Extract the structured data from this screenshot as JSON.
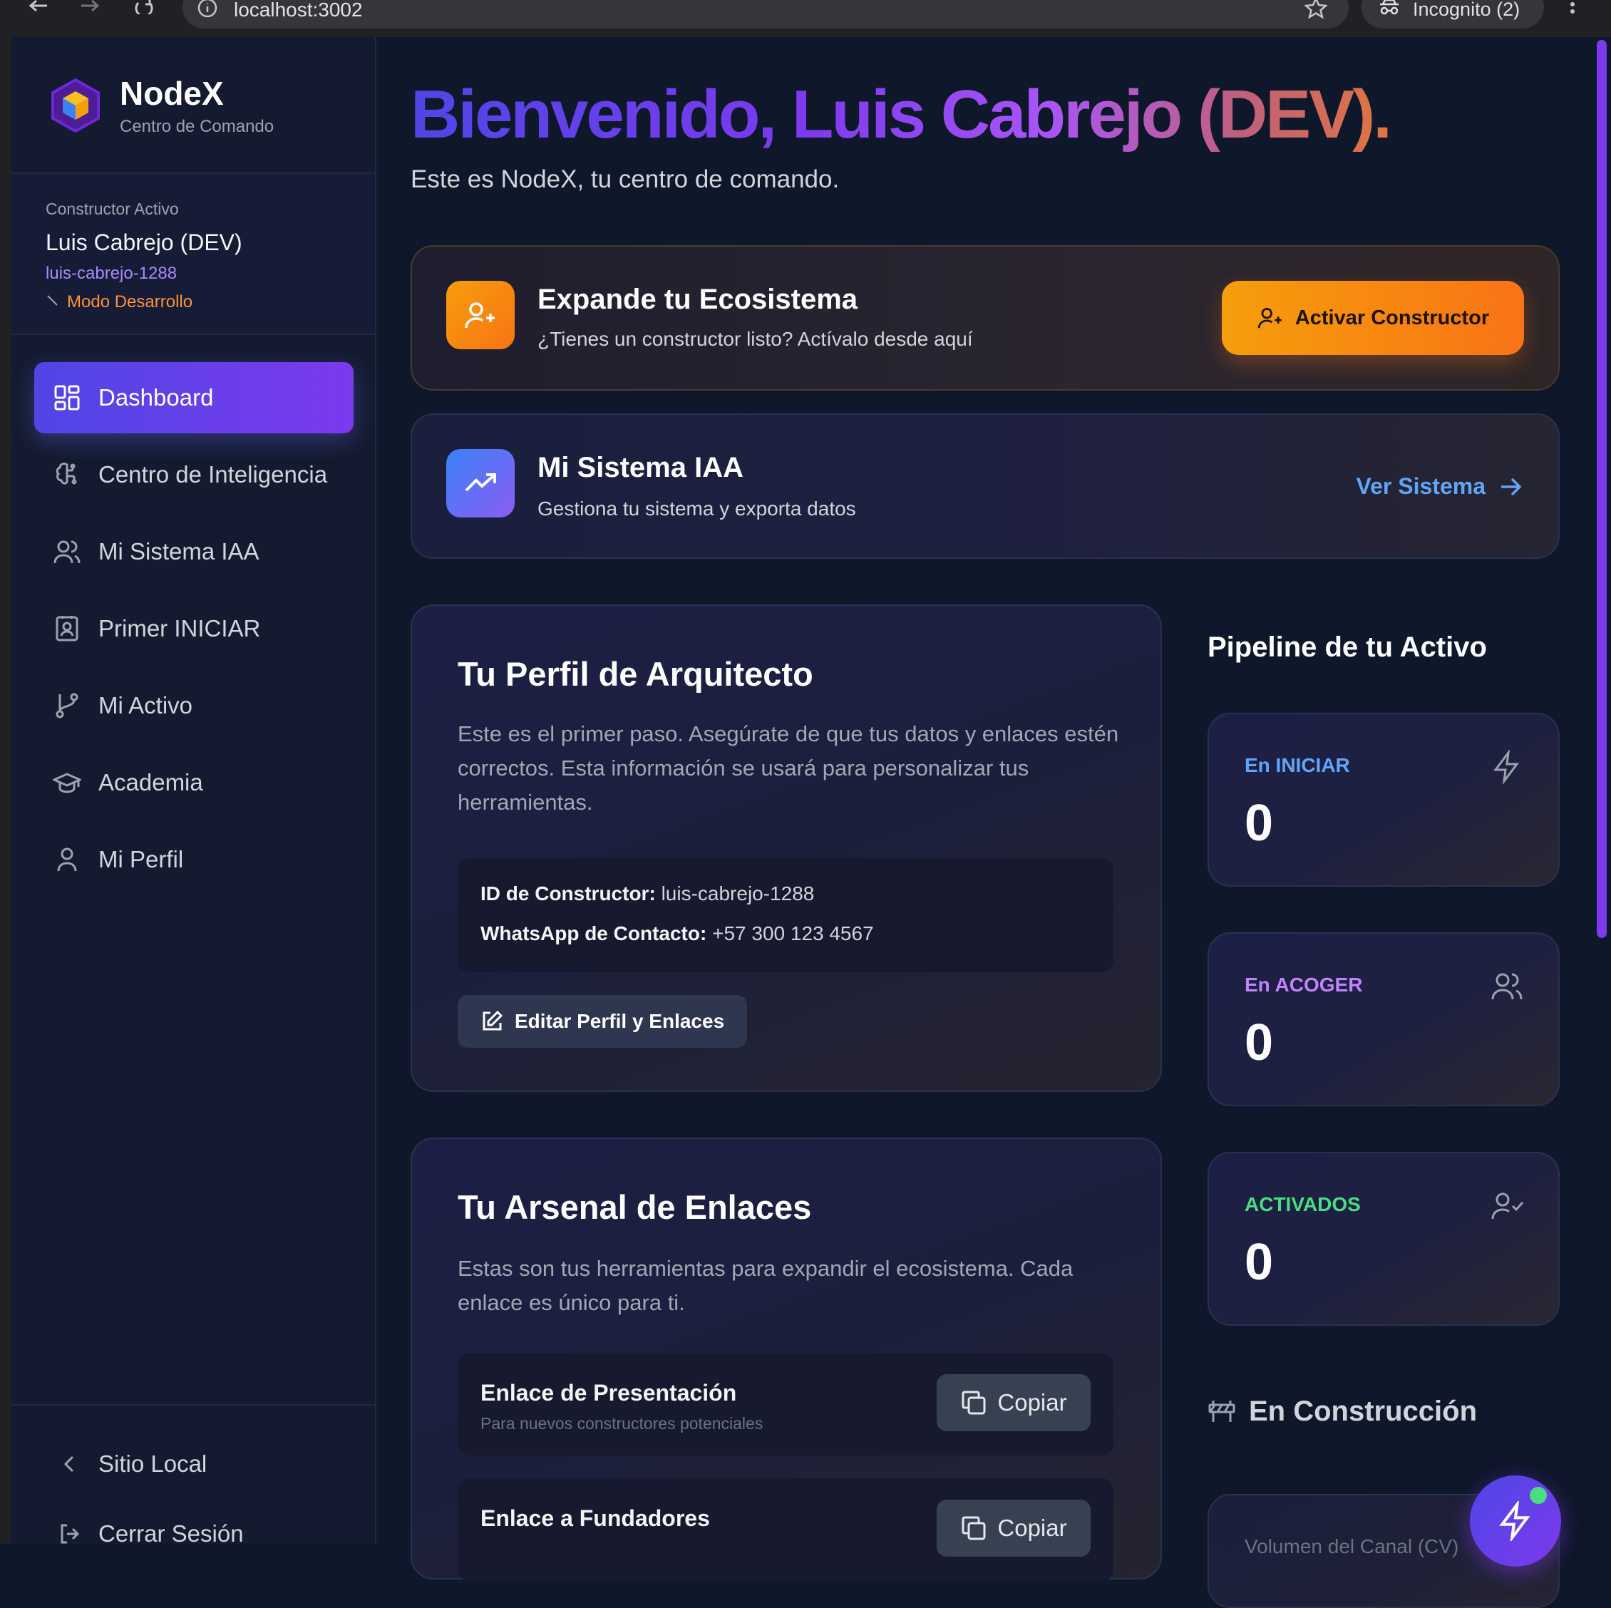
{
  "browser": {
    "url": "localhost:3002",
    "incognito_label": "Incognito (2)"
  },
  "sidebar": {
    "brand": {
      "name": "NodeX",
      "tagline": "Centro de Comando",
      "logo_icon": "cube-logo-icon"
    },
    "active_builder": {
      "label": "Constructor Activo",
      "name": "Luis Cabrejo (DEV)",
      "id": "luis-cabrejo-1288",
      "mode": "Modo Desarrollo"
    },
    "items": [
      {
        "label": "Dashboard",
        "icon": "grid-icon",
        "active": true
      },
      {
        "label": "Centro de Inteligencia",
        "icon": "brain-icon",
        "active": false
      },
      {
        "label": "Mi Sistema IAA",
        "icon": "users-icon",
        "active": false
      },
      {
        "label": "Primer INICIAR",
        "icon": "contact-icon",
        "active": false
      },
      {
        "label": "Mi Activo",
        "icon": "git-branch-icon",
        "active": false
      },
      {
        "label": "Academia",
        "icon": "graduation-cap-icon",
        "active": false
      },
      {
        "label": "Mi Perfil",
        "icon": "user-icon",
        "active": false
      }
    ],
    "footer": [
      {
        "label": "Sitio Local",
        "icon": "chevron-left-icon"
      },
      {
        "label": "Cerrar Sesión",
        "icon": "logout-icon"
      }
    ]
  },
  "main": {
    "title": "Bienvenido, Luis Cabrejo (DEV).",
    "subtitle": "Este es NodeX, tu centro de comando.",
    "ecosystem": {
      "title": "Expande tu Ecosistema",
      "subtitle": "¿Tienes un constructor listo? Actívalo desde aquí",
      "button": "Activar Constructor"
    },
    "iaa": {
      "title": "Mi Sistema IAA",
      "subtitle": "Gestiona tu sistema y exporta datos",
      "link": "Ver Sistema"
    },
    "profile": {
      "title": "Tu Perfil de Arquitecto",
      "description": "Este es el primer paso. Asegúrate de que tus datos y enlaces estén correctos. Esta información se usará para personalizar tus herramientas.",
      "id_label": "ID de Constructor:",
      "id_value": "luis-cabrejo-1288",
      "whatsapp_label": "WhatsApp de Contacto:",
      "whatsapp_value": "+57 300 123 4567",
      "edit_button": "Editar Perfil y Enlaces"
    },
    "arsenal": {
      "title": "Tu Arsenal de Enlaces",
      "description": "Estas son tus herramientas para expandir el ecosistema. Cada enlace es único para ti.",
      "links": [
        {
          "title": "Enlace de Presentación",
          "subtitle": "Para nuevos constructores potenciales",
          "button": "Copiar"
        },
        {
          "title": "Enlace a Fundadores",
          "subtitle": "",
          "button": "Copiar"
        }
      ]
    },
    "pipeline": {
      "title": "Pipeline de tu Activo",
      "stats": [
        {
          "label": "En INICIAR",
          "value": "0",
          "color": "#60a5fa",
          "icon": "zap-icon"
        },
        {
          "label": "En ACOGER",
          "value": "0",
          "color": "#c084fc",
          "icon": "users-icon"
        },
        {
          "label": "ACTIVADOS",
          "value": "0",
          "color": "#4ade80",
          "icon": "user-check-icon"
        }
      ],
      "construction_title": "En Construcción",
      "volume_label": "Volumen del Canal (CV)"
    }
  },
  "colors": {
    "accent": "#6366f1",
    "orange": "#f97316",
    "link_blue": "#60a5fa"
  }
}
